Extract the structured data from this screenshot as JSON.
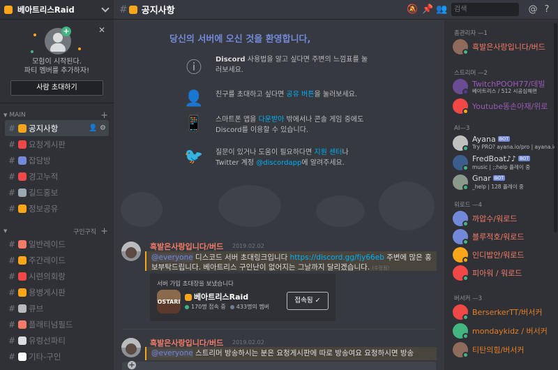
{
  "server": {
    "name": "베아트리스Raid"
  },
  "invite_panel": {
    "close": "✕",
    "line1": "모험이 시작된다.",
    "line2": "파티 멤버를 추가하자!",
    "button": "사람 초대하기"
  },
  "sidebar": {
    "category_main": "MAIN",
    "category_recruit": "구인구직",
    "channels_main": [
      {
        "label": "공지사항",
        "emoji_color": "#faa61a"
      },
      {
        "label": "요청게시판",
        "emoji_color": "#f04747"
      },
      {
        "label": "잡담방",
        "emoji_color": "#7289da"
      },
      {
        "label": "경고누적",
        "emoji_color": "#f04747"
      },
      {
        "label": "길드홍보",
        "emoji_color": "#99aab5"
      },
      {
        "label": "정보공유",
        "emoji_color": "#faa61a"
      }
    ],
    "channels_recruit": [
      {
        "label": "일반레이드",
        "emoji_color": "#f47b67"
      },
      {
        "label": "주간레이드",
        "emoji_color": "#faa61a"
      },
      {
        "label": "시련의회랑",
        "emoji_color": "#f04747"
      },
      {
        "label": "용병게시판",
        "emoji_color": "#faa61a"
      },
      {
        "label": "큐브",
        "emoji_color": "#b9bbbe"
      },
      {
        "label": "플래티넘필드",
        "emoji_color": "#f47b67"
      },
      {
        "label": "유령선파티",
        "emoji_color": "#dcddde"
      },
      {
        "label": "기타-구인",
        "emoji_color": "#ffffff"
      }
    ]
  },
  "topbar": {
    "channel_name": "공지사항",
    "search_placeholder": "검색",
    "icons": [
      "mute-icon",
      "pin-icon",
      "members-icon",
      "search-icon",
      "at-icon",
      "help-icon"
    ]
  },
  "welcome": {
    "title": "당신의 서버에 오신 것을 환영합니다,",
    "row1_strong": "Discord",
    "row1_text": " 사용법을 알고 싶다면 주변의 느낌표를 눌러보세요.",
    "row2_pre": "친구를 초대하고 싶다면 ",
    "row2_link": "공유 버튼",
    "row2_post": "을 눌러보세요.",
    "row3_pre": "스마트폰 앱을 ",
    "row3_link": "다운받아",
    "row3_post": " 밖에서나 콘솔 게임 중에도 Discord를 이용할 수 있습니다.",
    "row4_pre": "질문이 있거나 도움이 필요하다면 ",
    "row4_link": "지원 센터",
    "row4_mid": "나 Twitter 계정 ",
    "row4_link2": "@discordapp",
    "row4_post": "에 알려주세요."
  },
  "messages": [
    {
      "author": "흑발은사랑입니다/버드",
      "time": "2019.02.02",
      "mention": "@everyone",
      "text_pre": " 디스코드 서버 초대링크입니다 ",
      "link": "https://discord.gg/fjy66eb",
      "text_post": " 주변에 많은 홍보부탁드립니다. 베아트리스 구인난이 없어지는 그날까지 달리겠습니다.",
      "edited": "(수정됨)"
    },
    {
      "author": "흑발은사랑입니다/버드",
      "time": "2019.02.02",
      "mention": "@everyone",
      "text": " 스트리머 방송하시는 분은 요청게시판에 따로 방송여요 요청하시면 방송"
    }
  ],
  "invite_card": {
    "title": "서버 가입 초대장을 보냈습니다",
    "server_name": "베아트리스Raid",
    "online": "170명 접속 중",
    "members": "433명의 멤버",
    "button": "접속됨",
    "icon_text": "OSTARI"
  },
  "member_groups": [
    {
      "title": "총관리자 —1",
      "members": [
        {
          "name": "흑발은사랑입니다/버드",
          "color": "#f47b67",
          "status": "#43b581",
          "avatar": "#8e6b5a"
        }
      ]
    },
    {
      "title": "스트리머 —2",
      "members": [
        {
          "name": "TwitchPOOH77/데빌",
          "sub": "베아트리스 / 512 시공심해편",
          "color": "#9b59b6",
          "status": "#593695",
          "avatar": "#6a4c93"
        },
        {
          "name": "Youtube똥손아재/위로",
          "color": "#9b59b6",
          "status": "#faa61a",
          "avatar": "#f04747"
        }
      ]
    },
    {
      "title": "AI—3",
      "members": [
        {
          "name": "Ayana",
          "sub": "Try PRO? ayana.io/pro | ayana.io",
          "color": "#dcddde",
          "status": "#43b581",
          "avatar": "#c0c0c0",
          "bot": "BOT"
        },
        {
          "name": "FredBoat♪♪",
          "sub": "music | ;;help 플레이 중",
          "color": "#dcddde",
          "status": "#43b581",
          "avatar": "#3b5e8c",
          "bot": "BOT"
        },
        {
          "name": "Gnar",
          "sub": "_help | 128 플레이 중",
          "color": "#dcddde",
          "status": "#43b581",
          "avatar": "#8a9a8a",
          "bot": "BOT"
        }
      ]
    },
    {
      "title": "워로드 —4",
      "members": [
        {
          "name": "까압수/워로드",
          "color": "#f47b67",
          "status": "#43b581",
          "avatar": "#7289da"
        },
        {
          "name": "블루적호/워로드",
          "color": "#f47b67",
          "status": "#43b581",
          "avatar": "#7289da"
        },
        {
          "name": "인디밥안/워로드",
          "color": "#f47b67",
          "status": "#faa61a",
          "avatar": "#faa61a"
        },
        {
          "name": "피아워 / 워로드",
          "color": "#f47b67",
          "status": "#43b581",
          "avatar": "#f04747"
        }
      ]
    },
    {
      "title": "버서커 —3",
      "members": [
        {
          "name": "BerserkerTT/버서커",
          "color": "#e67e22",
          "status": "#43b581",
          "avatar": "#f04747"
        },
        {
          "name": "mondaykidz / 버서커",
          "color": "#e67e22",
          "status": "#43b581",
          "avatar": "#43b581"
        },
        {
          "name": "티탄의힘/버서커",
          "color": "#e67e22",
          "status": "#43b581",
          "avatar": "#8e6b5a"
        }
      ]
    }
  ]
}
